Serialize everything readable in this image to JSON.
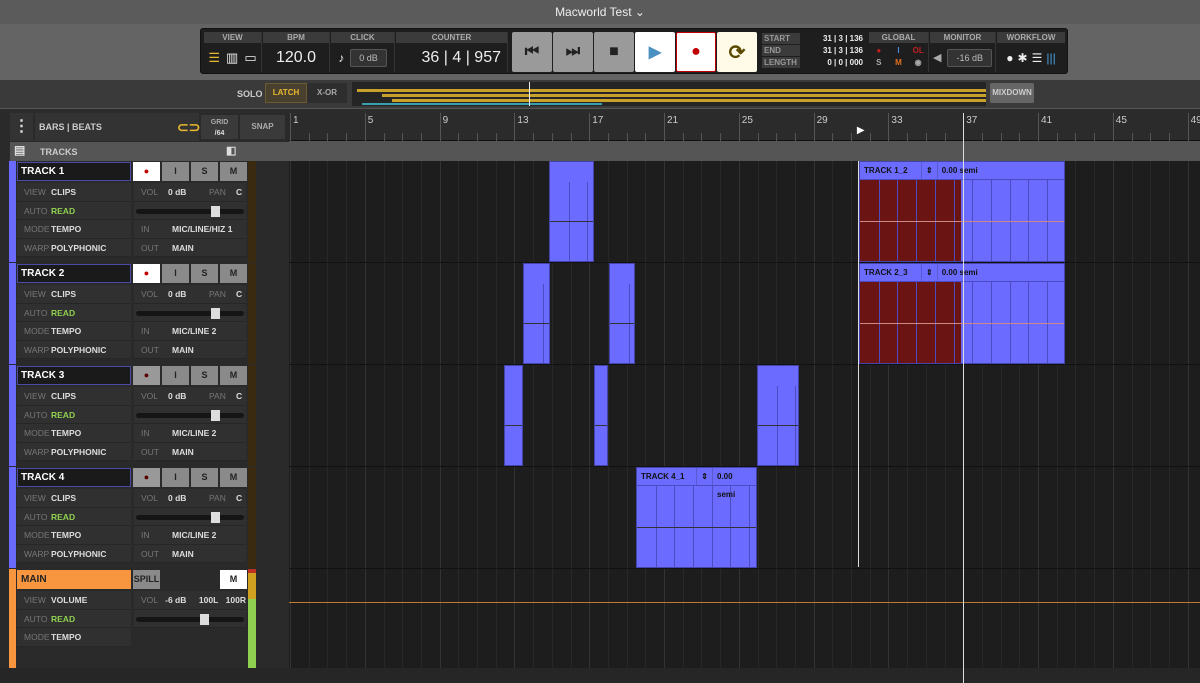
{
  "window": {
    "title": "Macworld Test ⌄"
  },
  "transport": {
    "view": {
      "label": "VIEW"
    },
    "bpm": {
      "label": "BPM",
      "value": "120.0"
    },
    "click": {
      "label": "CLICK",
      "value": "0 dB"
    },
    "counter": {
      "label": "COUNTER",
      "value": "36 | 4 | 957"
    },
    "loop": {
      "start_label": "START",
      "end_label": "END",
      "length_label": "LENGTH",
      "start": "31 | 3 | 136",
      "end": "31 | 3 | 136",
      "length": "0 | 0 | 000"
    },
    "global": {
      "label": "GLOBAL",
      "i": "I",
      "ol": "OL",
      "s": "S",
      "m": "M"
    },
    "monitor": {
      "label": "MONITOR",
      "value": "-16 dB"
    },
    "workflow": {
      "label": "WORKFLOW"
    }
  },
  "solo": {
    "label": "SOLO",
    "latch": "LATCH",
    "xor": "X-OR",
    "mixdown": "MIXDOWN"
  },
  "header": {
    "timebase": "BARS | BEATS",
    "grid": "GRID",
    "grid_value": "/64",
    "snap": "SNAP",
    "tracks": "TRACKS"
  },
  "ruler": {
    "bars": [
      "1",
      "5",
      "9",
      "13",
      "17",
      "21",
      "25",
      "29",
      "33",
      "37",
      "41",
      "45",
      "49"
    ],
    "playhead_bar": 36.99,
    "loop_start_bar": 31.53
  },
  "colors": {
    "clip": "#6b6bff",
    "track": "#6a6aff",
    "main": "#f7963e",
    "record": "#c00000",
    "selected_clip": "#6a1414"
  },
  "tracks": [
    {
      "name": "TRACK 1",
      "view": "CLIPS",
      "auto": "READ",
      "mode": "TEMPO",
      "warp": "POLYPHONIC",
      "vol": "0 dB",
      "pan": "C",
      "in": "MIC/LINE/HIZ 1",
      "out": "MAIN",
      "fader": 0.75,
      "rec_armed": true,
      "clips": [
        {
          "start": 14.85,
          "end": 17.26
        },
        {
          "start": 31.43,
          "end": 42.44,
          "name": "TRACK 1_2",
          "pitch": "0.00 semi",
          "selected_to": 36.85
        }
      ]
    },
    {
      "name": "TRACK 2",
      "view": "CLIPS",
      "auto": "READ",
      "mode": "TEMPO",
      "warp": "POLYPHONIC",
      "vol": "0 dB",
      "pan": "C",
      "in": "MIC/LINE 2",
      "out": "MAIN",
      "fader": 0.75,
      "rec_armed": true,
      "clips": [
        {
          "start": 13.46,
          "end": 14.9
        },
        {
          "start": 18.06,
          "end": 19.45
        },
        {
          "start": 31.43,
          "end": 42.44,
          "name": "TRACK 2_3",
          "pitch": "0.00 semi",
          "selected_to": 36.85
        }
      ]
    },
    {
      "name": "TRACK 3",
      "view": "CLIPS",
      "auto": "READ",
      "mode": "TEMPO",
      "warp": "POLYPHONIC",
      "vol": "0 dB",
      "pan": "C",
      "in": "MIC/LINE 2",
      "out": "MAIN",
      "fader": 0.75,
      "rec_armed": false,
      "clips": [
        {
          "start": 12.44,
          "end": 13.46
        },
        {
          "start": 17.26,
          "end": 18.0
        },
        {
          "start": 25.97,
          "end": 28.2
        }
      ]
    },
    {
      "name": "TRACK 4",
      "view": "CLIPS",
      "auto": "READ",
      "mode": "TEMPO",
      "warp": "POLYPHONIC",
      "vol": "0 dB",
      "pan": "C",
      "in": "MIC/LINE 2",
      "out": "MAIN",
      "fader": 0.75,
      "rec_armed": false,
      "clips": [
        {
          "start": 19.5,
          "end": 25.97,
          "name": "TRACK 4_1",
          "pitch": "0.00 semi"
        }
      ]
    }
  ],
  "main": {
    "name": "MAIN",
    "spill": "SPILL",
    "mute": "M",
    "view": "VOLUME",
    "auto": "READ",
    "mode": "TEMPO",
    "vol": "-6 dB",
    "pan_l": "100L",
    "pan_r": "100R",
    "fader": 0.65
  },
  "labels": {
    "view": "VIEW",
    "auto": "AUTO",
    "mode": "MODE",
    "warp": "WARP",
    "vol": "VOL",
    "pan": "PAN",
    "in": "IN",
    "out": "OUT",
    "i": "I",
    "s": "S",
    "m": "M"
  }
}
